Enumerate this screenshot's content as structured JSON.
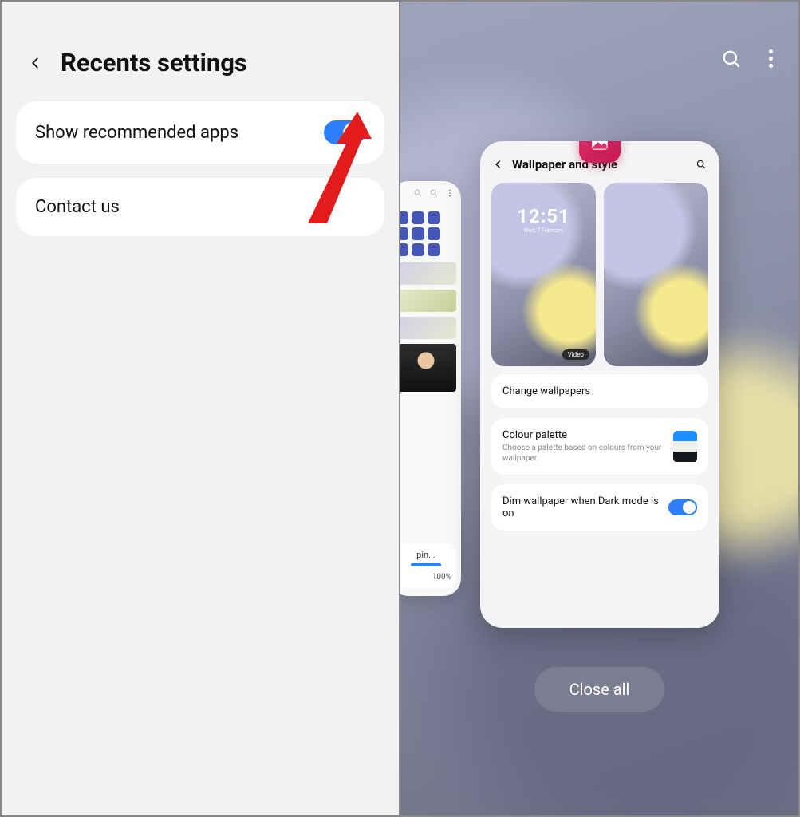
{
  "left": {
    "title": "Recents settings",
    "rows": {
      "recommended": {
        "label": "Show recommended apps",
        "on": true
      },
      "contact": {
        "label": "Contact us"
      }
    }
  },
  "right": {
    "close_all": "Close all",
    "prev_card": {
      "join_label": "pin...",
      "percent": "100%"
    },
    "main_card": {
      "app_icon": "gallery-icon",
      "title": "Wallpaper and style",
      "lock_clock": "12:51",
      "lock_date": "Wed, 7 February",
      "video_badge": "Video",
      "change_wallpapers": "Change wallpapers",
      "colour_palette": {
        "title": "Colour palette",
        "sub": "Choose a palette based on colours from your wallpaper."
      },
      "dim_dark": {
        "title": "Dim wallpaper when Dark mode is on",
        "on": true
      }
    }
  },
  "colors": {
    "accent": "#2d7ff9",
    "annotation": "#e21c1c"
  }
}
